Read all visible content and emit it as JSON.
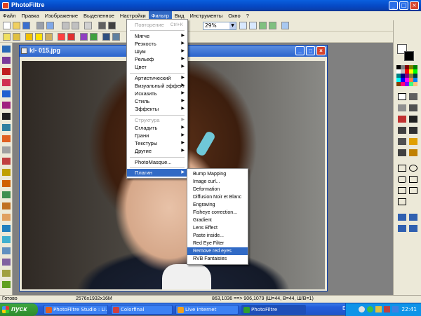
{
  "app": {
    "title": "PhotoFiltre"
  },
  "menubar": [
    "Файл",
    "Правка",
    "Изображение",
    "Выделенное",
    "Настройки",
    "Фильтр",
    "Вид",
    "Инструменты",
    "Окно",
    "?"
  ],
  "toolbar": {
    "zoom": "29%"
  },
  "document": {
    "title": "kl- 015.jpg"
  },
  "filter_menu": {
    "repeat": "Повторение",
    "repeat_shortcut": "Ctrl+K",
    "items": [
      "Мягче",
      "Резкость",
      "Шум",
      "Рельеф",
      "Цвет",
      "Артистический",
      "Визуальный эффект",
      "Исказить",
      "Стиль",
      "Эффекты",
      "Структура",
      "Сгладить",
      "Грани",
      "Текстуры",
      "Другие",
      "PhotoMasque...",
      "Плагин"
    ]
  },
  "plugin_submenu": {
    "items": [
      "Bump Mapping",
      "Image curl...",
      "Deformation",
      "Diffusion Noir et Blanc",
      "Engraving",
      "Fisheye correction...",
      "Gradient",
      "Lens Effect",
      "Paste inside...",
      "Red Eye Filter",
      "Remove red eyes",
      "RVB Fantaisies"
    ]
  },
  "statusbar": {
    "state": "Готово",
    "size": "2576x1932x16M",
    "coords": "863,1036 ==> 906,1079 (Ш=44, В=44, Ш/В=1)"
  },
  "taskbar": {
    "start": "пуск",
    "tasks": [
      "PhotoFiltre Studio : Li...",
      "Colorfinal",
      "Live Internet",
      "PhotoFiltre"
    ],
    "lang": "EN",
    "clock": "22:41"
  },
  "colors": {
    "accent": "#316ac5",
    "titlebar": "#0548c4",
    "taskbar": "#245edb"
  }
}
